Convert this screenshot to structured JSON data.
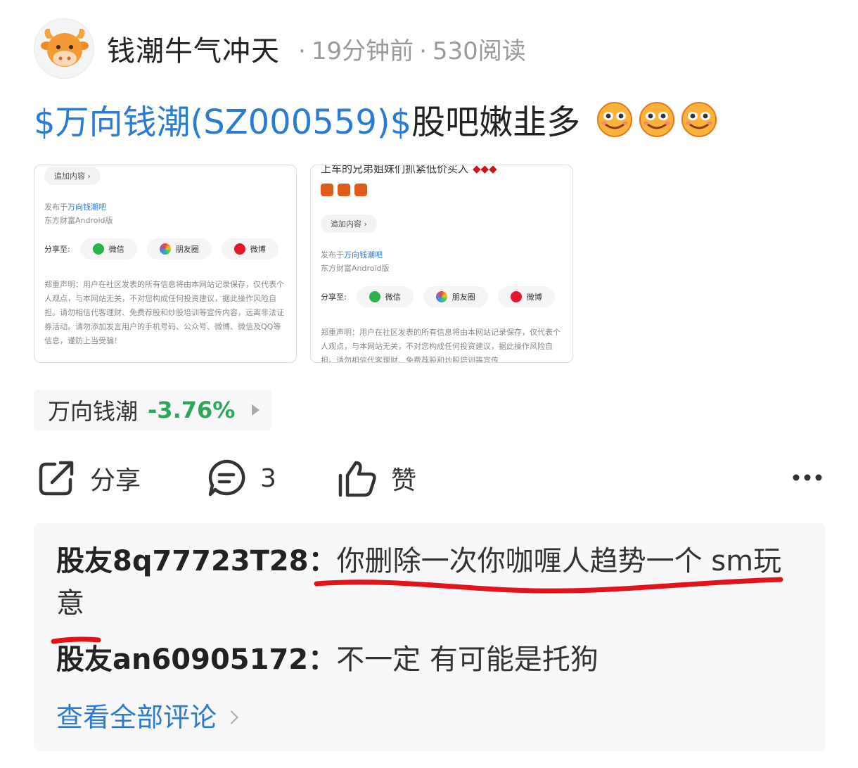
{
  "author": {
    "name": "钱潮牛气冲天",
    "time": "19分钟前",
    "reads": "530阅读",
    "separator": "·",
    "avatar_icon": "ox-head-icon"
  },
  "post": {
    "stock_tag": "$万向钱潮(SZ000559)$",
    "text": "股吧嫩韭多",
    "emoji_icon": "grinning-emoji-icon"
  },
  "screenshot_left": {
    "add_content": "追加内容 ›",
    "published_prefix": "发布于",
    "published_forum": "万向钱潮吧",
    "client": "东方财富Android版",
    "share_to": "分享至:",
    "share_options": [
      "微信",
      "朋友圈",
      "微博"
    ],
    "disclaimer": "郑重声明：用户在社区发表的所有信息将由本网站记录保存，仅代表个人观点，与本网站无关，不对您构成任何投资建议，据此操作风险自担。请勿相信代客理财、免费荐股和炒股培训等宣传内容，远离非法证券活动。请勿添加发言用户的手机号码、公众号、微博、微信及QQ等信息，谨防上当受骗！"
  },
  "screenshot_right": {
    "top_text": "上车的兄弟姐妹们抓紧低价买入",
    "add_content": "追加内容 ›",
    "published_prefix": "发布于",
    "published_forum": "万向钱潮吧",
    "client": "东方财富Android版",
    "share_to": "分享至:",
    "share_options": [
      "微信",
      "朋友圈",
      "微博"
    ],
    "disclaimer": "郑重声明：用户在社区发表的所有信息将由本网站记录保存，仅代表个人观点，与本网站无关，不对您构成任何投资建议，据此操作风险自担。请勿相信代客理财、免费荐股和炒股培训等宣传"
  },
  "stock_chip": {
    "name": "万向钱潮",
    "change": "-3.76%",
    "change_color": "#2ea65b"
  },
  "actions": {
    "share": "分享",
    "comments": "3",
    "like": "赞"
  },
  "comments": [
    {
      "user": "股友8q77723T28：",
      "text": "你删除一次你咖喱人趋势一个 sm玩",
      "text_cont": "意"
    },
    {
      "user": "股友an60905172：",
      "text": "不一定 有可能是托狗"
    }
  ],
  "view_all": "查看全部评论",
  "colors": {
    "link_blue": "#2b7bd6",
    "down_green": "#2ea65b",
    "annotation_red": "#e0141a"
  }
}
